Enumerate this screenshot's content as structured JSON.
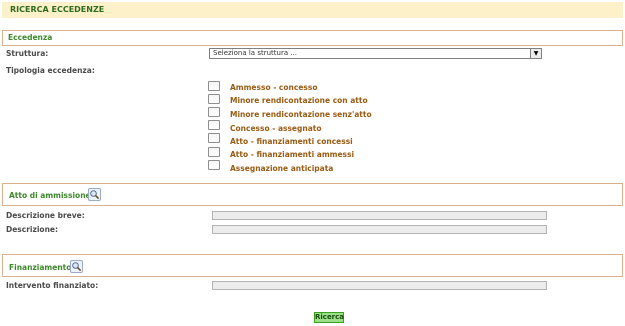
{
  "page": {
    "title": "RICERCA ECCEDENZE"
  },
  "eccedenza": {
    "section_title": "Eccedenza",
    "struttura_label": "Struttura:",
    "struttura_value": "Seleziona la struttura ...",
    "tipologia_label": "Tipologia eccedenza:",
    "options": [
      "Ammesso - concesso",
      "Minore rendicontazione con atto",
      "Minore rendicontazione senz'atto",
      "Concesso - assegnato",
      "Atto - finanziamenti concessi",
      "Atto - finanziamenti ammessi",
      "Assegnazione anticipata"
    ]
  },
  "atto": {
    "section_title": "Atto di ammissione",
    "descr_breve_label": "Descrizione breve:",
    "descr_breve_value": "",
    "descr_label": "Descrizione:",
    "descr_value": ""
  },
  "finanziamento": {
    "section_title": "Finanziamento",
    "intervento_label": "Intervento finanziato:",
    "intervento_value": ""
  },
  "actions": {
    "search_label": "Ricerca"
  },
  "icons": {
    "lookup": "magnifier-icon"
  },
  "colors": {
    "header_bg": "#fdf1c9",
    "section_title": "#3d8a2a",
    "option_text": "#9a5b12",
    "button_bg": "#9be089"
  }
}
